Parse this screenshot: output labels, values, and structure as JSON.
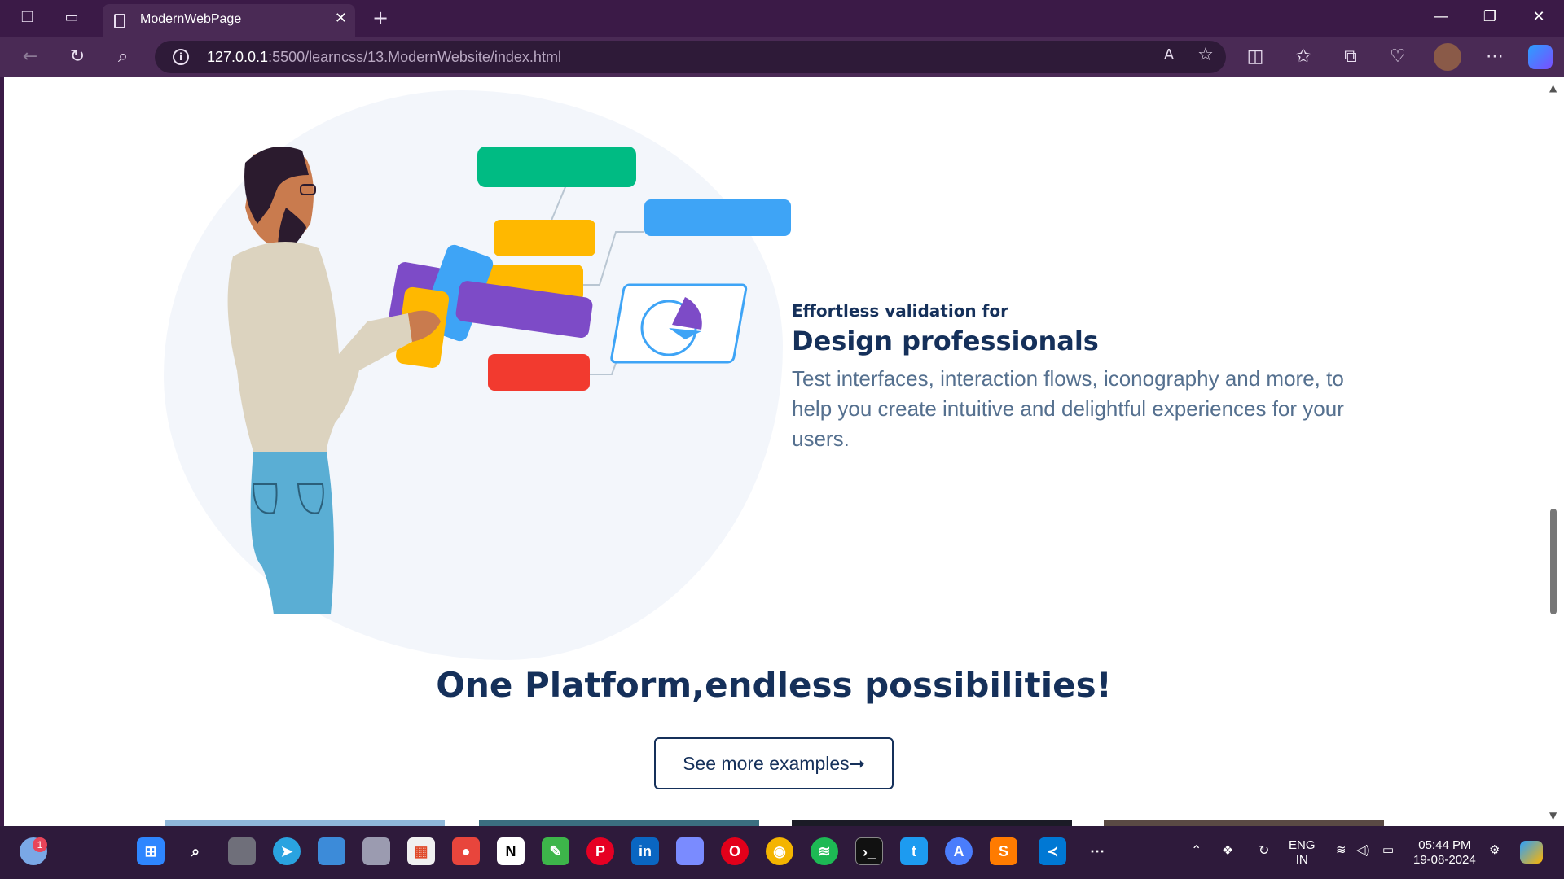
{
  "browser": {
    "tab_title": "ModernWebPage",
    "url_host": "127.0.0.1",
    "url_rest": ":5500/learncss/13.ModernWebsite/index.html"
  },
  "content": {
    "kicker": "Effortless validation for",
    "heading": "Design professionals",
    "body": "Test interfaces, interaction flows, iconography and more, to help you create intuitive and delightful experiences for your users.",
    "section_title": "One Platform,endless possibilities!",
    "cta_label": "See more examples➞"
  },
  "taskbar": {
    "notification_count": "1",
    "lang_line1": "ENG",
    "lang_line2": "IN",
    "time": "05:44 PM",
    "date": "19-08-2024"
  },
  "colors": {
    "green_card": "#00bb83",
    "blue_card": "#3ea4f6",
    "yellow_card": "#ffb800",
    "purple_card": "#7d4bc7",
    "red_card": "#f23a2f",
    "brand_navy": "#15305a"
  }
}
